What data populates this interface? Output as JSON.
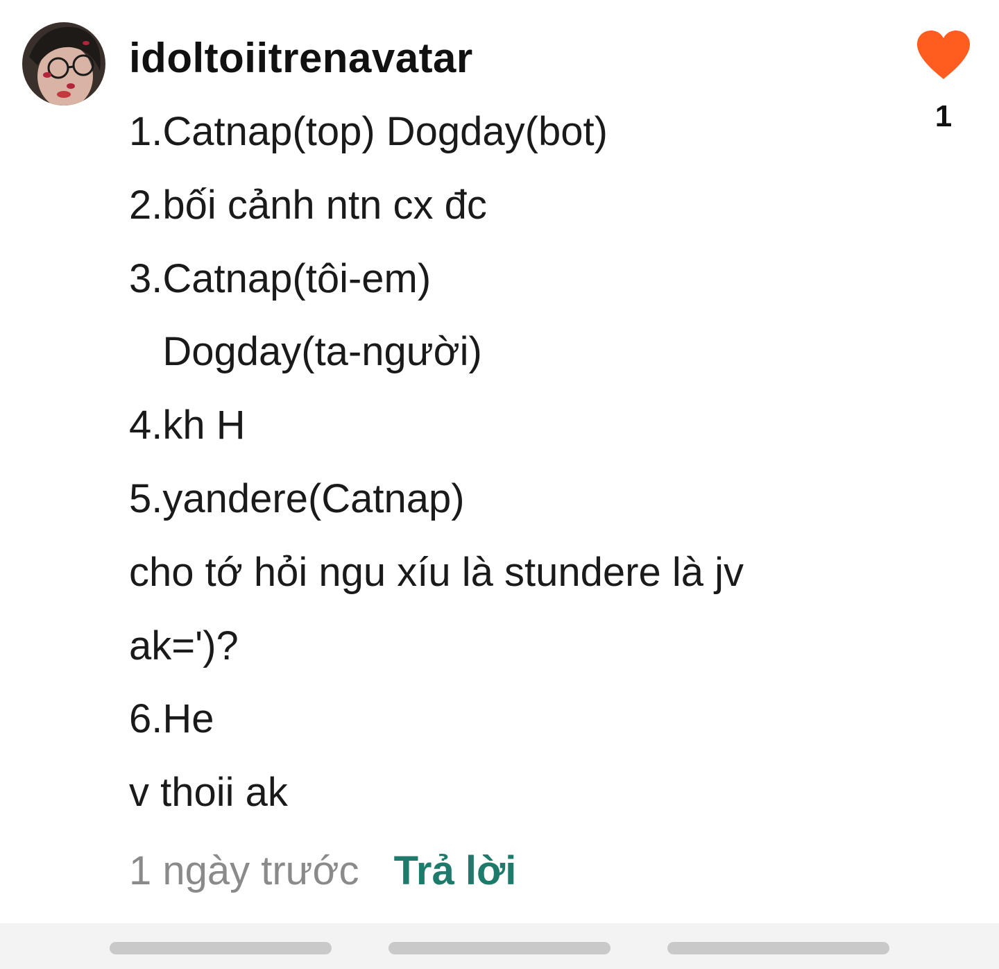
{
  "comment": {
    "username": "idoltoiitrenavatar",
    "avatar_icon": "user-avatar-photo",
    "lines": [
      "1.Catnap(top) Dogday(bot)",
      "2.bối cảnh ntn cx đc",
      "3.Catnap(tôi-em)",
      "   Dogday(ta-người)",
      "4.kh H",
      "5.yandere(Catnap)",
      "cho tớ hỏi ngu xíu là stundere là jv",
      "ak=')?",
      "6.He",
      "v thoii ak"
    ],
    "timestamp": "1 ngày trước",
    "reply_label": "Trả lời",
    "like_icon": "heart-icon",
    "like_count": "1"
  },
  "colors": {
    "heart": "#ff5c1f",
    "reply": "#1e7a6a",
    "timestamp": "#8a8a8a",
    "text": "#1a1a1a",
    "bottom_bar": "#f3f3f3",
    "scroll_pill": "#c9c9c9"
  }
}
